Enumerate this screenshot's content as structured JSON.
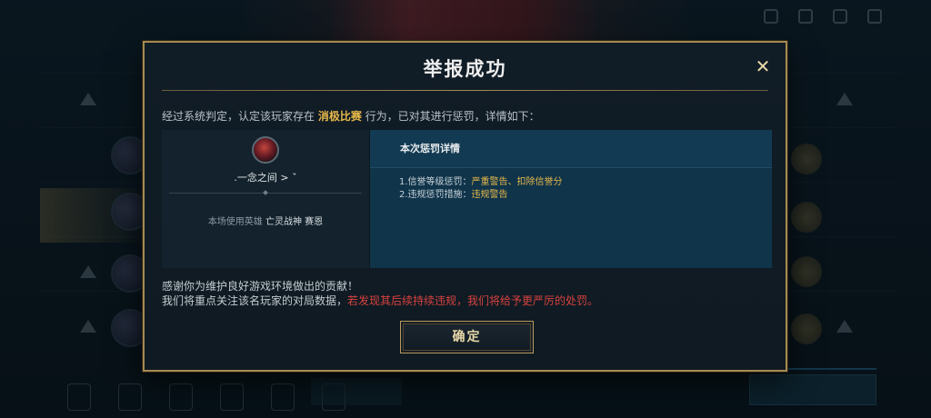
{
  "dialog": {
    "title": "举报成功",
    "close_icon": "close-icon",
    "intro_prefix": "经过系统判定，认定该玩家存在 ",
    "intro_violation": "消极比赛",
    "intro_suffix": " 行为，已对其进行惩罚，详情如下：",
    "player": {
      "name": ".一念之间 > ˇ",
      "hero_prefix": "本场使用英雄 ",
      "hero_name": "亡灵战神 赛恩"
    },
    "details": {
      "heading": "本次惩罚详情",
      "item1_prefix": "1.信誉等级惩罚：",
      "item1_value": "严重警告、扣除信誉分",
      "item2_prefix": "2.违规惩罚措施：",
      "item2_value": "违规警告"
    },
    "thanks_line1": "感谢你为维护良好游戏环境做出的贡献！",
    "thanks_line2_prefix": "我们将重点关注该名玩家的对局数据，",
    "thanks_line2_warning": "若发现其后续持续违规，我们将给予更严厉的处罚。",
    "confirm_label": "确定"
  },
  "colors": {
    "accent_gold": "#e6b84a",
    "warning_red": "#d8423f",
    "border_gold": "#a58a52",
    "detail_panel": "#10344a"
  }
}
